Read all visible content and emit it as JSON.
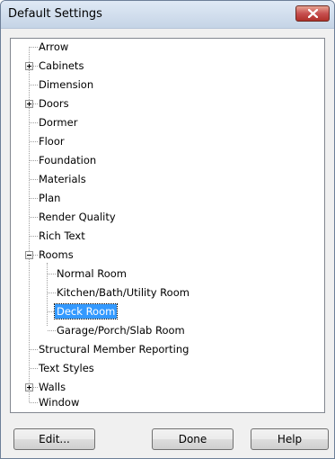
{
  "window": {
    "title": "Default Settings",
    "close_icon": "close-x-icon"
  },
  "tree": {
    "items": [
      {
        "label": "Arrow",
        "expandable": false
      },
      {
        "label": "Cabinets",
        "expandable": true,
        "expanded": false
      },
      {
        "label": "Dimension",
        "expandable": false
      },
      {
        "label": "Doors",
        "expandable": true,
        "expanded": false
      },
      {
        "label": "Dormer",
        "expandable": false
      },
      {
        "label": "Floor",
        "expandable": false
      },
      {
        "label": "Foundation",
        "expandable": false
      },
      {
        "label": "Materials",
        "expandable": false
      },
      {
        "label": "Plan",
        "expandable": false
      },
      {
        "label": "Render Quality",
        "expandable": false
      },
      {
        "label": "Rich Text",
        "expandable": false
      },
      {
        "label": "Rooms",
        "expandable": true,
        "expanded": true,
        "children": [
          {
            "label": "Normal Room"
          },
          {
            "label": "Kitchen/Bath/Utility Room"
          },
          {
            "label": "Deck Room",
            "selected": true
          },
          {
            "label": "Garage/Porch/Slab Room"
          }
        ]
      },
      {
        "label": "Structural Member Reporting",
        "expandable": false
      },
      {
        "label": "Text Styles",
        "expandable": false
      },
      {
        "label": "Walls",
        "expandable": true,
        "expanded": false
      },
      {
        "label": "Window",
        "expandable": false
      }
    ],
    "selection_color": "#3399ff"
  },
  "buttons": {
    "edit": "Edit...",
    "done": "Done",
    "help": "Help"
  }
}
